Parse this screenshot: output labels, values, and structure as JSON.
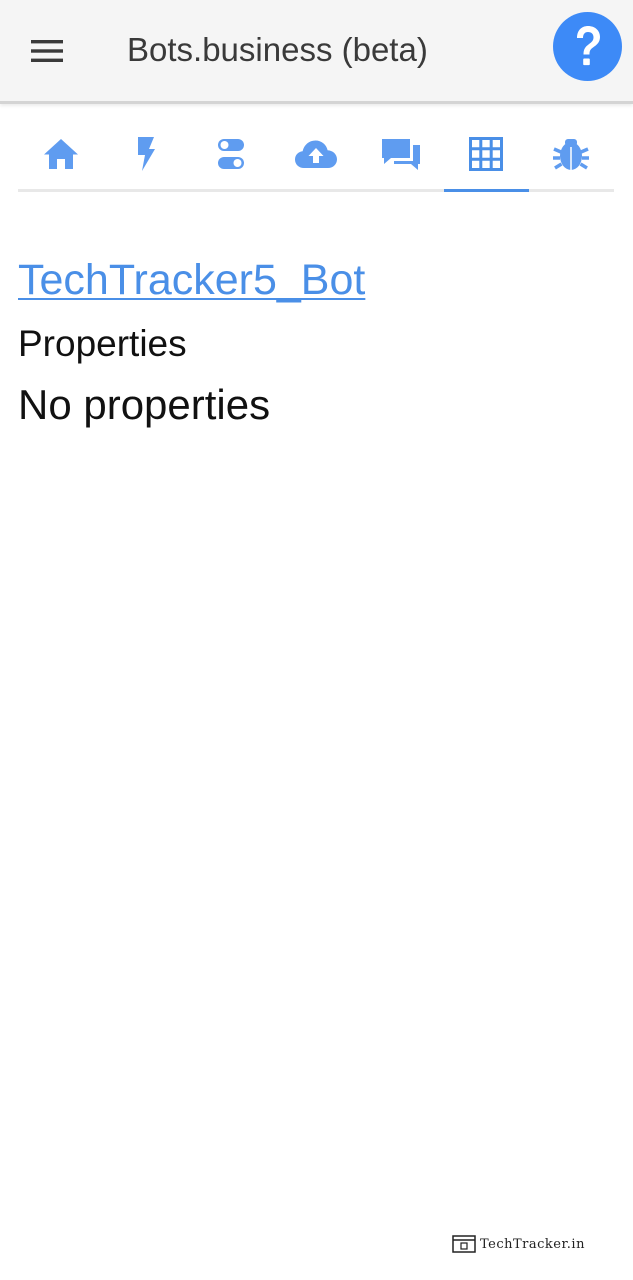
{
  "header": {
    "menu_icon": "hamburger-menu-icon",
    "title": "Bots.business (beta)",
    "help_icon": "question-mark-icon",
    "help_color": "#3d8af7"
  },
  "tabs": [
    {
      "icon": "home-icon",
      "active": false
    },
    {
      "icon": "lightning-bolt-icon",
      "active": false
    },
    {
      "icon": "toggle-settings-icon",
      "active": false
    },
    {
      "icon": "cloud-upload-icon",
      "active": false
    },
    {
      "icon": "chat-bubbles-icon",
      "active": false
    },
    {
      "icon": "grid-table-icon",
      "active": true
    },
    {
      "icon": "bug-icon",
      "active": false
    }
  ],
  "accent_color": "#4a8fe7",
  "main": {
    "bot_name": "TechTracker5_Bot",
    "section_title": "Properties",
    "empty_message": "No properties"
  },
  "watermark": {
    "text": "TechTracker.in"
  }
}
